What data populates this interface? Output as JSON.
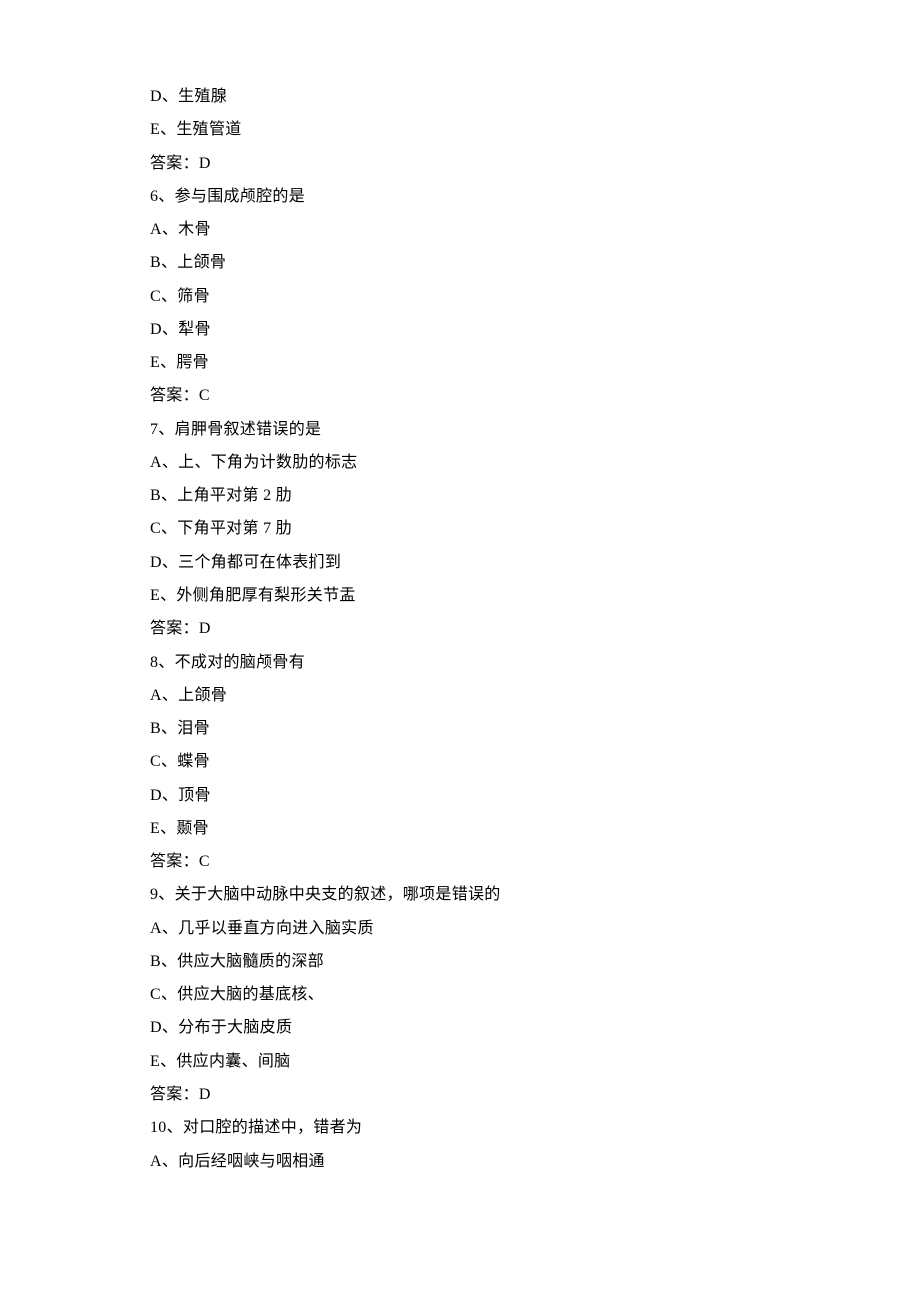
{
  "lines": [
    "D、生殖腺",
    "E、生殖管道",
    "答案：D",
    "6、参与围成颅腔的是",
    "A、木骨",
    "B、上颌骨",
    "C、筛骨",
    "D、犁骨",
    "E、腭骨",
    "答案：C",
    "7、肩胛骨叙述错误的是",
    "A、上、下角为计数肋的标志",
    "B、上角平对第 2 肋",
    "C、下角平对第 7 肋",
    "D、三个角都可在体表扪到",
    "E、外侧角肥厚有梨形关节盂",
    "答案：D",
    "8、不成对的脑颅骨有",
    "A、上颌骨",
    "B、泪骨",
    "C、蝶骨",
    "D、顶骨",
    "E、颞骨",
    "答案：C",
    "9、关于大脑中动脉中央支的叙述，哪项是错误的",
    "A、几乎以垂直方向进入脑实质",
    "B、供应大脑髓质的深部",
    "C、供应大脑的基底核、",
    "D、分布于大脑皮质",
    "E、供应内囊、间脑",
    "答案：D",
    "10、对口腔的描述中，错者为",
    "A、向后经咽峡与咽相通"
  ]
}
